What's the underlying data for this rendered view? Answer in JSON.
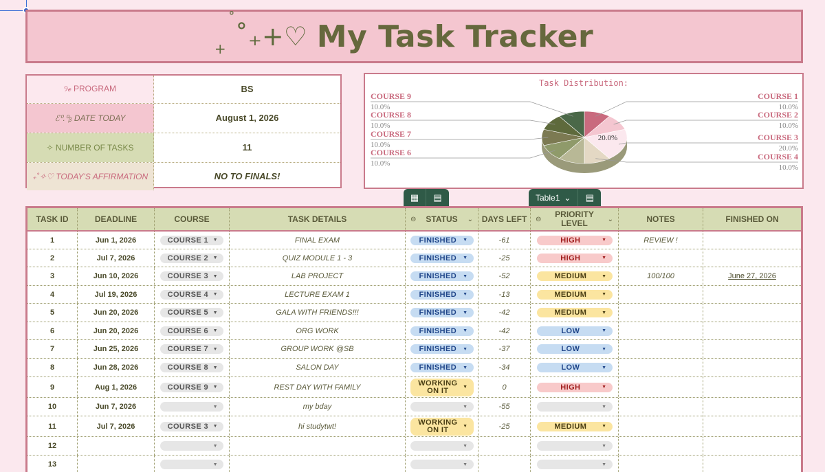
{
  "title": {
    "decoration": "˚₊+♡",
    "text": "My Task Tracker"
  },
  "info": {
    "program_label": "୨ℯ PROGRAM",
    "program_value": "BS",
    "date_label": "ℰ⁰.⁰ᵦ DATE TODAY",
    "date_value": "August 1, 2026",
    "tasks_label": "✧ NUMBER OF TASKS",
    "tasks_value": "11",
    "affirmation_label": "₊˚✧♡ TODAY'S AFFIRMATION",
    "affirmation_value": "NO TO FINALS!"
  },
  "chart_data": {
    "type": "pie",
    "title": "Task Distribution:",
    "categories": [
      "COURSE 1",
      "COURSE 2",
      "COURSE 3",
      "COURSE 4",
      "COURSE 5",
      "COURSE 6",
      "COURSE 7",
      "COURSE 8",
      "COURSE 9"
    ],
    "values": [
      10.0,
      10.0,
      20.0,
      10.0,
      10.0,
      10.0,
      10.0,
      10.0,
      10.0
    ],
    "value_labels": [
      "10.0%",
      "10.0%",
      "20.0%",
      "10.0%",
      "10.0%",
      "10.0%",
      "10.0%",
      "10.0%",
      "10.0%"
    ],
    "inside_label": "20.0%",
    "colors": [
      "#c96a7e",
      "#f4c6d0",
      "#fbe8ee",
      "#e4d8c4",
      "#b8b896",
      "#8f9a6a",
      "#7c7a52",
      "#5e6a3c",
      "#4a6848"
    ]
  },
  "tabs": {
    "table_name": "Table1"
  },
  "table": {
    "headers": {
      "id": "TASK ID",
      "deadline": "DEADLINE",
      "course": "COURSE",
      "details": "TASK DETAILS",
      "status": "STATUS",
      "days": "DAYS LEFT",
      "priority": "PRIORITY LEVEL",
      "notes": "NOTES",
      "finished": "FINISHED ON"
    },
    "rows": [
      {
        "id": "1",
        "deadline": "Jun 1, 2026",
        "course": "COURSE 1",
        "details": "FINAL EXAM",
        "status": "FINISHED",
        "days": "-61",
        "priority": "HIGH",
        "notes": "REVIEW !",
        "finished": ""
      },
      {
        "id": "2",
        "deadline": "Jul 7, 2026",
        "course": "COURSE 2",
        "details": "QUIZ MODULE 1 - 3",
        "status": "FINISHED",
        "days": "-25",
        "priority": "HIGH",
        "notes": "",
        "finished": ""
      },
      {
        "id": "3",
        "deadline": "Jun 10, 2026",
        "course": "COURSE 3",
        "details": "LAB PROJECT",
        "status": "FINISHED",
        "days": "-52",
        "priority": "MEDIUM",
        "notes": "100/100",
        "finished": "June 27, 2026"
      },
      {
        "id": "4",
        "deadline": "Jul 19, 2026",
        "course": "COURSE 4",
        "details": "LECTURE EXAM 1",
        "status": "FINISHED",
        "days": "-13",
        "priority": "MEDIUM",
        "notes": "",
        "finished": ""
      },
      {
        "id": "5",
        "deadline": "Jun 20, 2026",
        "course": "COURSE 5",
        "details": "GALA WITH FRIENDS!!!",
        "status": "FINISHED",
        "days": "-42",
        "priority": "MEDIUM",
        "notes": "",
        "finished": ""
      },
      {
        "id": "6",
        "deadline": "Jun 20, 2026",
        "course": "COURSE 6",
        "details": "ORG WORK",
        "status": "FINISHED",
        "days": "-42",
        "priority": "LOW",
        "notes": "",
        "finished": ""
      },
      {
        "id": "7",
        "deadline": "Jun 25, 2026",
        "course": "COURSE 7",
        "details": "GROUP WORK @SB",
        "status": "FINISHED",
        "days": "-37",
        "priority": "LOW",
        "notes": "",
        "finished": ""
      },
      {
        "id": "8",
        "deadline": "Jun 28, 2026",
        "course": "COURSE 8",
        "details": "SALON DAY",
        "status": "FINISHED",
        "days": "-34",
        "priority": "LOW",
        "notes": "",
        "finished": ""
      },
      {
        "id": "9",
        "deadline": "Aug 1, 2026",
        "course": "COURSE 9",
        "details": "REST DAY WITH FAMILY",
        "status": "WORKING ON IT",
        "days": "0",
        "priority": "HIGH",
        "notes": "",
        "finished": ""
      },
      {
        "id": "10",
        "deadline": "Jun 7, 2026",
        "course": "",
        "details": "my bday",
        "status": "",
        "days": "-55",
        "priority": "",
        "notes": "",
        "finished": ""
      },
      {
        "id": "11",
        "deadline": "Jul 7, 2026",
        "course": "COURSE 3",
        "details": "hi studytwt!",
        "status": "WORKING ON IT",
        "days": "-25",
        "priority": "MEDIUM",
        "notes": "",
        "finished": ""
      },
      {
        "id": "12",
        "deadline": "",
        "course": "",
        "details": "",
        "status": "",
        "days": "",
        "priority": "",
        "notes": "",
        "finished": ""
      },
      {
        "id": "13",
        "deadline": "",
        "course": "",
        "details": "",
        "status": "",
        "days": "",
        "priority": "",
        "notes": "",
        "finished": ""
      }
    ]
  }
}
